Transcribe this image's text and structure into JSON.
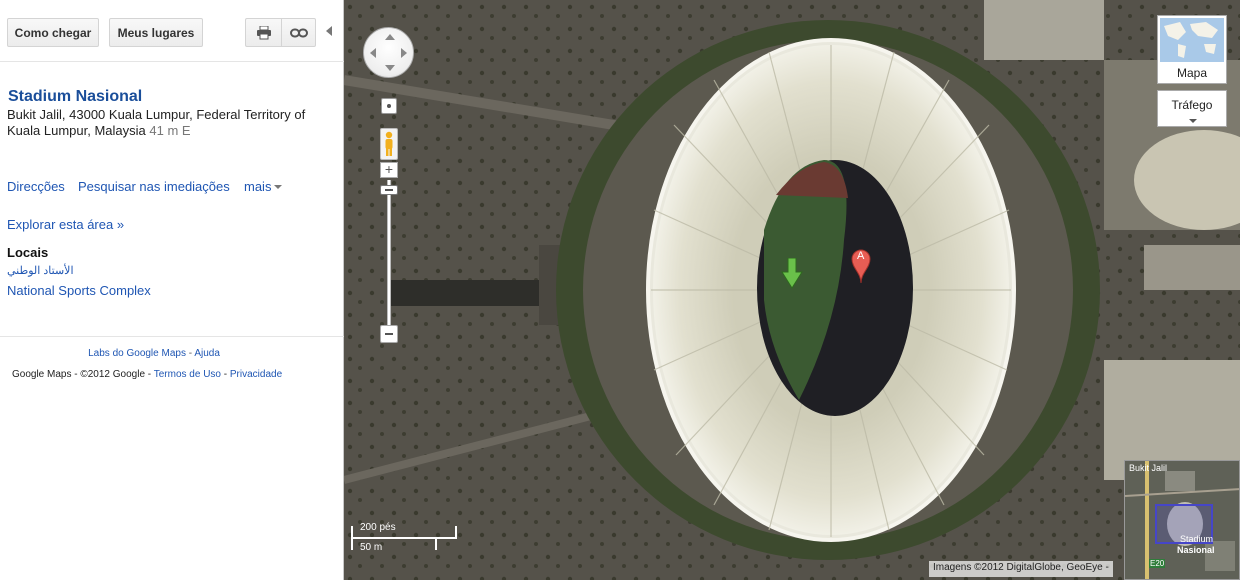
{
  "toolbar": {
    "directions_label": "Como chegar",
    "my_places_label": "Meus lugares"
  },
  "place": {
    "title": "Stadium Nasional",
    "address": "Bukit Jalil, 43000 Kuala Lumpur, Federal Territory of Kuala Lumpur, Malaysia",
    "elevation": "41 m E"
  },
  "actions": {
    "directions": "Direcções",
    "search_nearby": "Pesquisar nas imediações",
    "more": "mais",
    "explore": "Explorar esta área »"
  },
  "locais": {
    "heading": "Locais",
    "arabic_name": "الأستاد الوطني",
    "complex_name": "National Sports Complex"
  },
  "footer": {
    "labs": "Labs do Google Maps",
    "sep": "-",
    "help": "Ajuda",
    "copyright": "Google Maps - ©2012 Google -",
    "terms": "Termos de Uso",
    "privacy": "Privacidade"
  },
  "map": {
    "type_label": "Mapa",
    "traffic_label": "Tráfego",
    "scale_ft": "200 pés",
    "scale_m": "50 m",
    "imagery_credit": "Imagens ©2012 DigitalGlobe, GeoEye -",
    "marker_label": "A",
    "overview": {
      "label_top": "Bukit Jalil",
      "label_stadium": "Stadium",
      "label_nasional": "Nasional",
      "road": "E20"
    }
  }
}
